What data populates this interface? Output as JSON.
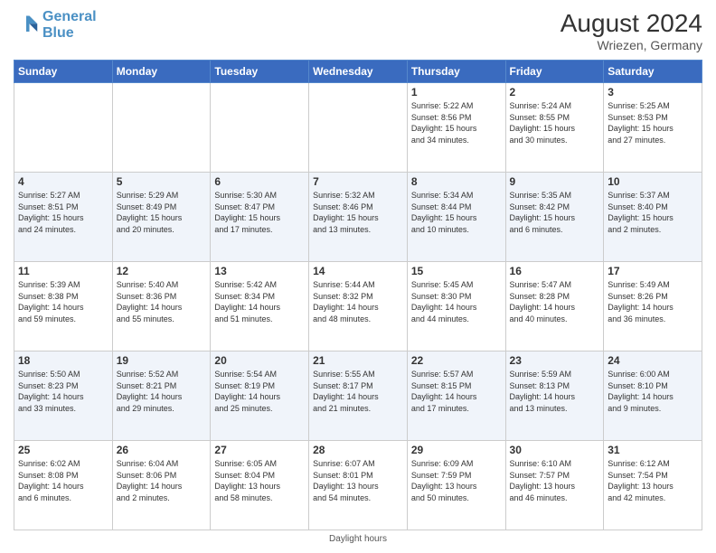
{
  "header": {
    "logo_line1": "General",
    "logo_line2": "Blue",
    "month_year": "August 2024",
    "location": "Wriezen, Germany"
  },
  "footer": {
    "daylight_label": "Daylight hours"
  },
  "weekdays": [
    "Sunday",
    "Monday",
    "Tuesday",
    "Wednesday",
    "Thursday",
    "Friday",
    "Saturday"
  ],
  "weeks": [
    {
      "row_style": "white-row",
      "days": [
        {
          "num": "",
          "info": ""
        },
        {
          "num": "",
          "info": ""
        },
        {
          "num": "",
          "info": ""
        },
        {
          "num": "",
          "info": ""
        },
        {
          "num": "1",
          "info": "Sunrise: 5:22 AM\nSunset: 8:56 PM\nDaylight: 15 hours\nand 34 minutes."
        },
        {
          "num": "2",
          "info": "Sunrise: 5:24 AM\nSunset: 8:55 PM\nDaylight: 15 hours\nand 30 minutes."
        },
        {
          "num": "3",
          "info": "Sunrise: 5:25 AM\nSunset: 8:53 PM\nDaylight: 15 hours\nand 27 minutes."
        }
      ]
    },
    {
      "row_style": "alt-row",
      "days": [
        {
          "num": "4",
          "info": "Sunrise: 5:27 AM\nSunset: 8:51 PM\nDaylight: 15 hours\nand 24 minutes."
        },
        {
          "num": "5",
          "info": "Sunrise: 5:29 AM\nSunset: 8:49 PM\nDaylight: 15 hours\nand 20 minutes."
        },
        {
          "num": "6",
          "info": "Sunrise: 5:30 AM\nSunset: 8:47 PM\nDaylight: 15 hours\nand 17 minutes."
        },
        {
          "num": "7",
          "info": "Sunrise: 5:32 AM\nSunset: 8:46 PM\nDaylight: 15 hours\nand 13 minutes."
        },
        {
          "num": "8",
          "info": "Sunrise: 5:34 AM\nSunset: 8:44 PM\nDaylight: 15 hours\nand 10 minutes."
        },
        {
          "num": "9",
          "info": "Sunrise: 5:35 AM\nSunset: 8:42 PM\nDaylight: 15 hours\nand 6 minutes."
        },
        {
          "num": "10",
          "info": "Sunrise: 5:37 AM\nSunset: 8:40 PM\nDaylight: 15 hours\nand 2 minutes."
        }
      ]
    },
    {
      "row_style": "white-row",
      "days": [
        {
          "num": "11",
          "info": "Sunrise: 5:39 AM\nSunset: 8:38 PM\nDaylight: 14 hours\nand 59 minutes."
        },
        {
          "num": "12",
          "info": "Sunrise: 5:40 AM\nSunset: 8:36 PM\nDaylight: 14 hours\nand 55 minutes."
        },
        {
          "num": "13",
          "info": "Sunrise: 5:42 AM\nSunset: 8:34 PM\nDaylight: 14 hours\nand 51 minutes."
        },
        {
          "num": "14",
          "info": "Sunrise: 5:44 AM\nSunset: 8:32 PM\nDaylight: 14 hours\nand 48 minutes."
        },
        {
          "num": "15",
          "info": "Sunrise: 5:45 AM\nSunset: 8:30 PM\nDaylight: 14 hours\nand 44 minutes."
        },
        {
          "num": "16",
          "info": "Sunrise: 5:47 AM\nSunset: 8:28 PM\nDaylight: 14 hours\nand 40 minutes."
        },
        {
          "num": "17",
          "info": "Sunrise: 5:49 AM\nSunset: 8:26 PM\nDaylight: 14 hours\nand 36 minutes."
        }
      ]
    },
    {
      "row_style": "alt-row",
      "days": [
        {
          "num": "18",
          "info": "Sunrise: 5:50 AM\nSunset: 8:23 PM\nDaylight: 14 hours\nand 33 minutes."
        },
        {
          "num": "19",
          "info": "Sunrise: 5:52 AM\nSunset: 8:21 PM\nDaylight: 14 hours\nand 29 minutes."
        },
        {
          "num": "20",
          "info": "Sunrise: 5:54 AM\nSunset: 8:19 PM\nDaylight: 14 hours\nand 25 minutes."
        },
        {
          "num": "21",
          "info": "Sunrise: 5:55 AM\nSunset: 8:17 PM\nDaylight: 14 hours\nand 21 minutes."
        },
        {
          "num": "22",
          "info": "Sunrise: 5:57 AM\nSunset: 8:15 PM\nDaylight: 14 hours\nand 17 minutes."
        },
        {
          "num": "23",
          "info": "Sunrise: 5:59 AM\nSunset: 8:13 PM\nDaylight: 14 hours\nand 13 minutes."
        },
        {
          "num": "24",
          "info": "Sunrise: 6:00 AM\nSunset: 8:10 PM\nDaylight: 14 hours\nand 9 minutes."
        }
      ]
    },
    {
      "row_style": "white-row",
      "days": [
        {
          "num": "25",
          "info": "Sunrise: 6:02 AM\nSunset: 8:08 PM\nDaylight: 14 hours\nand 6 minutes."
        },
        {
          "num": "26",
          "info": "Sunrise: 6:04 AM\nSunset: 8:06 PM\nDaylight: 14 hours\nand 2 minutes."
        },
        {
          "num": "27",
          "info": "Sunrise: 6:05 AM\nSunset: 8:04 PM\nDaylight: 13 hours\nand 58 minutes."
        },
        {
          "num": "28",
          "info": "Sunrise: 6:07 AM\nSunset: 8:01 PM\nDaylight: 13 hours\nand 54 minutes."
        },
        {
          "num": "29",
          "info": "Sunrise: 6:09 AM\nSunset: 7:59 PM\nDaylight: 13 hours\nand 50 minutes."
        },
        {
          "num": "30",
          "info": "Sunrise: 6:10 AM\nSunset: 7:57 PM\nDaylight: 13 hours\nand 46 minutes."
        },
        {
          "num": "31",
          "info": "Sunrise: 6:12 AM\nSunset: 7:54 PM\nDaylight: 13 hours\nand 42 minutes."
        }
      ]
    }
  ]
}
